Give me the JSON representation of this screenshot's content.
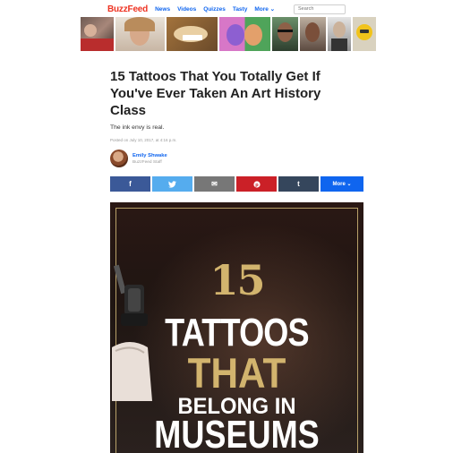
{
  "nav": {
    "logo": "BuzzFeed",
    "links": [
      "News",
      "Videos",
      "Quizzes",
      "Tasty"
    ],
    "more": "More",
    "search_placeholder": "Search",
    "logo_color": "#ee3322",
    "link_color": "#0f65ef"
  },
  "thumbnails": [
    {
      "name": "thumb-red-shirt",
      "color": "#8a6f66"
    },
    {
      "name": "thumb-woman",
      "color": "#c9a48a"
    },
    {
      "name": "thumb-food",
      "color": "#b48a5c"
    },
    {
      "name": "thumb-illustration",
      "color": "#c063b5"
    },
    {
      "name": "thumb-man-glasses",
      "color": "#5e7e5e"
    },
    {
      "name": "thumb-woman-2",
      "color": "#8f6f62"
    },
    {
      "name": "thumb-man-suit",
      "color": "#9b9b9b"
    },
    {
      "name": "thumb-emoji",
      "color": "#e3b200"
    }
  ],
  "article": {
    "headline": "15 Tattoos That You Totally Get If You've Ever Taken An Art History Class",
    "subhead": "The ink envy is real.",
    "posted": "Posted on July 10, 2017, at 4:16 p.m.",
    "author_name": "Emily Shwake",
    "author_role": "BuzzFeed Staff"
  },
  "share": {
    "facebook": {
      "label": "f",
      "color": "#3b5998"
    },
    "twitter": {
      "label": "🐦",
      "color": "#55acee"
    },
    "email": {
      "label": "✉",
      "color": "#777777"
    },
    "pinterest": {
      "label": "𝒑",
      "color": "#cb2027"
    },
    "tumblr": {
      "label": "t",
      "color": "#35465c"
    },
    "more": {
      "label": "More",
      "color": "#0f65ef"
    }
  },
  "hero": {
    "number": "15",
    "line1": "TATTOOS",
    "line2": "THAT",
    "line3": "BELONG IN",
    "line4": "MUSEUMS",
    "gold": "#d2b46e"
  }
}
